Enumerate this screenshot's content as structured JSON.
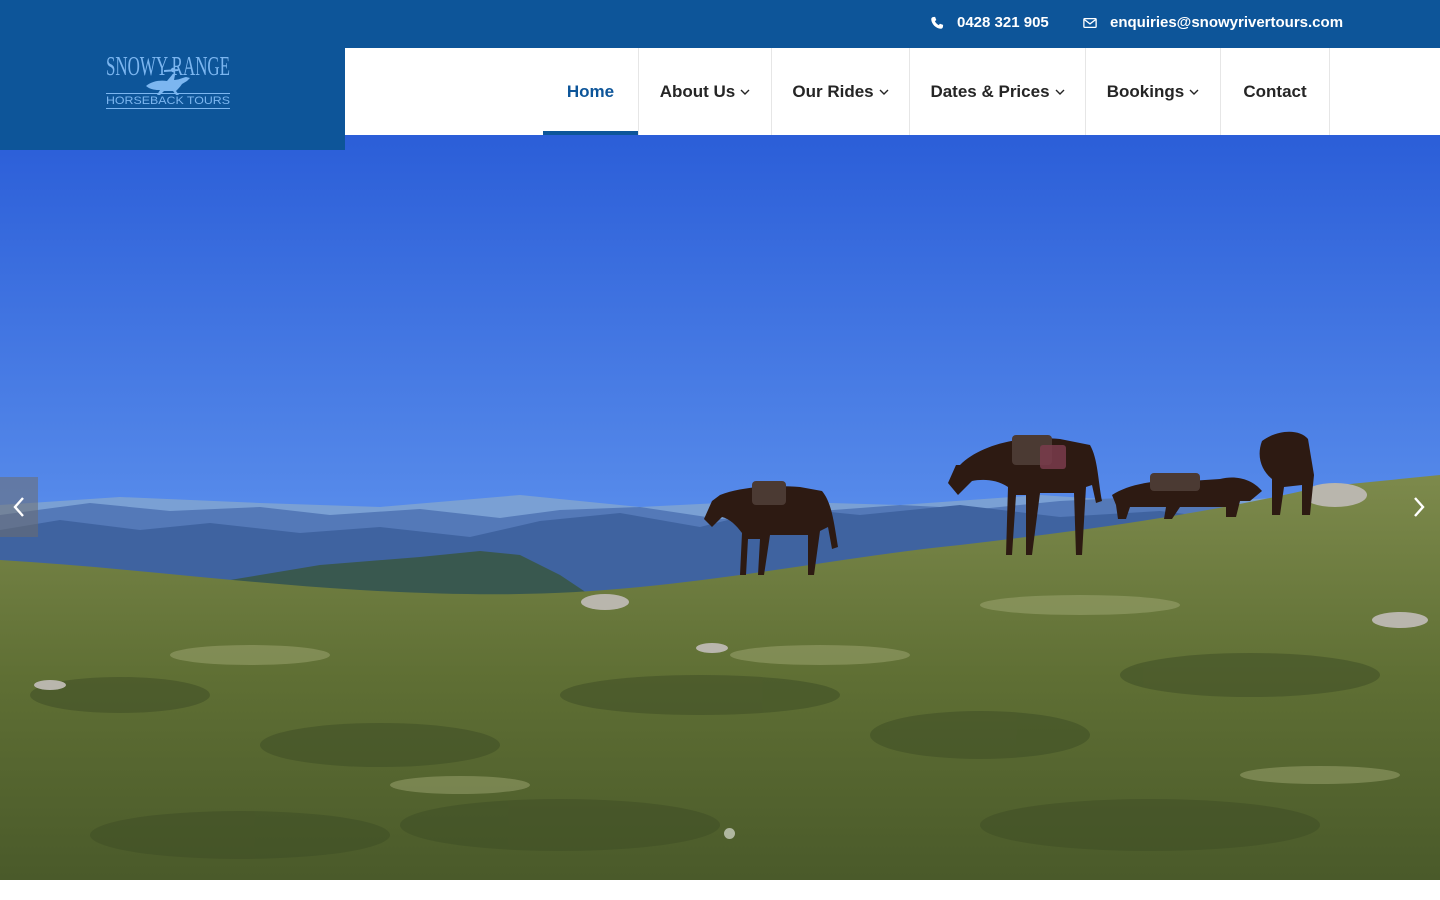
{
  "header": {
    "phone": "0428 321 905",
    "email": "enquiries@snowyrivertours.com",
    "phone_icon": "phone-icon",
    "email_icon": "envelope-icon"
  },
  "logo": {
    "line1": "SNOWY RANGE",
    "line2": "HORSEBACK TOURS",
    "color": "#7cb6f0"
  },
  "nav": {
    "items": [
      {
        "label": "Home",
        "active": true,
        "has_dropdown": false
      },
      {
        "label": "About Us",
        "active": false,
        "has_dropdown": true
      },
      {
        "label": "Our Rides",
        "active": false,
        "has_dropdown": true
      },
      {
        "label": "Dates & Prices",
        "active": false,
        "has_dropdown": true
      },
      {
        "label": "Bookings",
        "active": false,
        "has_dropdown": true
      },
      {
        "label": "Contact",
        "active": false,
        "has_dropdown": false
      }
    ]
  },
  "hero": {
    "image": "horses grazing on alpine ridge with mountain range behind",
    "prev_icon": "chevron-left-icon",
    "next_icon": "chevron-right-icon",
    "slide_count": 1,
    "active_slide": 1
  },
  "colors": {
    "brand": "#0d5599",
    "nav_text": "#252525",
    "sky_top": "#2b5ed8",
    "sky_bottom": "#7fb0f2",
    "grass": "#6b7a3c"
  }
}
